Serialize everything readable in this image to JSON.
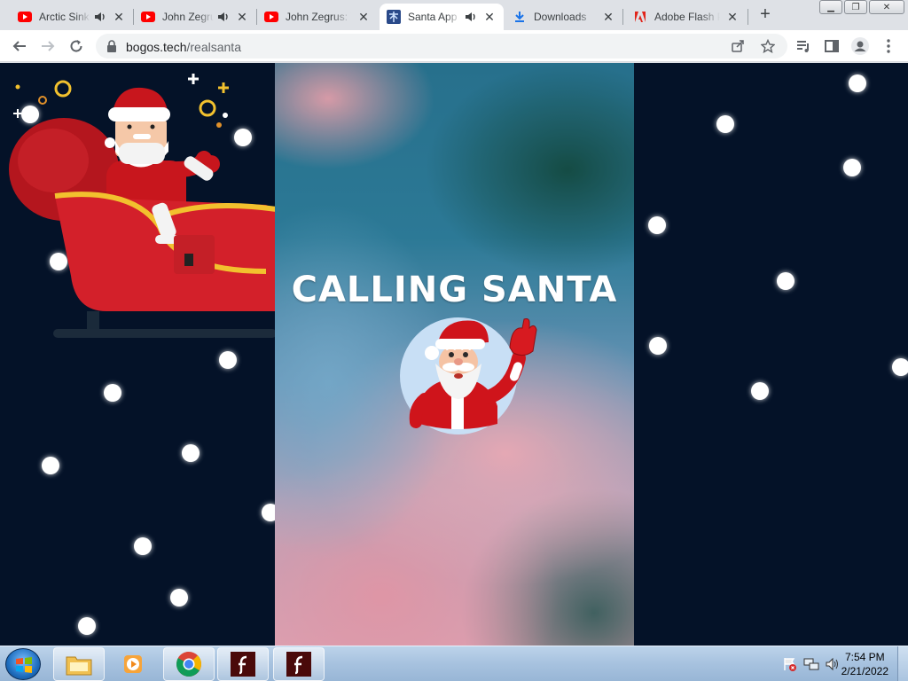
{
  "tabs": [
    {
      "title": "Arctic Sinks",
      "favicon": "youtube-icon",
      "audio": true
    },
    {
      "title": "John Zegrus",
      "favicon": "youtube-icon",
      "audio": true
    },
    {
      "title": "John Zegrus: T",
      "favicon": "youtube-icon",
      "audio": false
    },
    {
      "title": "Santa App",
      "favicon": "santa-app-icon",
      "audio": true,
      "active": true
    },
    {
      "title": "Downloads",
      "favicon": "download-icon",
      "audio": false
    },
    {
      "title": "Adobe Flash P",
      "favicon": "adobe-icon",
      "audio": false
    }
  ],
  "toolbar": {
    "url_host": "bogos.tech",
    "url_path": "/realsanta"
  },
  "page": {
    "heading": "CALLING SANTA",
    "background_color": "#041228"
  },
  "taskbar": {
    "apps": [
      {
        "name": "file-explorer-icon"
      },
      {
        "name": "media-player-icon"
      },
      {
        "name": "chrome-icon"
      },
      {
        "name": "flash-player-icon"
      },
      {
        "name": "flash-player-icon"
      }
    ],
    "time": "7:54 PM",
    "date": "2/21/2022"
  },
  "colors": {
    "youtube_red": "#ff0000",
    "adobe_red": "#e1251b",
    "santa_red": "#c8161d",
    "sleigh_red": "#d3202a",
    "gold": "#f2c12e"
  }
}
